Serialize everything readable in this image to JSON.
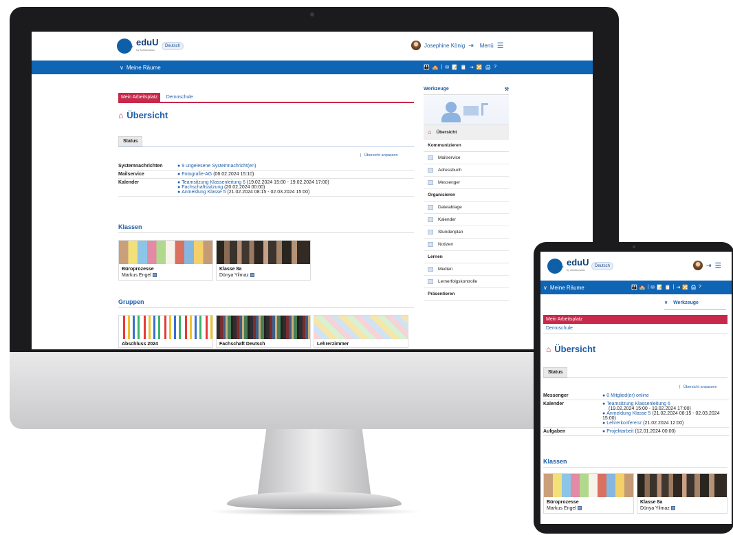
{
  "desktop": {
    "header": {
      "logo": "eduU",
      "logo_sub": "by Ashhkowaio",
      "language": "Deutsch",
      "user_name": "Josephine König",
      "menu": "Menü"
    },
    "bar": {
      "rooms": "Meine Räume",
      "icons": [
        "👪",
        "🏫",
        "|",
        "✉",
        "📝",
        "📋",
        "⇥",
        "🔀",
        "🖨",
        "?"
      ]
    },
    "tabs": {
      "active": "Mein Arbeitsplatz",
      "other": "Demoschule"
    },
    "title": "Übersicht",
    "status_tab": "Status",
    "customize": "Übersicht anpassen",
    "status_rows": [
      {
        "key": "Systemnachrichten",
        "lines": [
          {
            "link": "9 ungelesene Systemnachricht(en)",
            "rest": ""
          }
        ]
      },
      {
        "key": "Mailservice",
        "lines": [
          {
            "link": "Fotografie-AG",
            "rest": "(06.02.2024 15:10)"
          }
        ]
      },
      {
        "key": "Kalender",
        "lines": [
          {
            "link": "Teamsitzung Klassenleitung 6",
            "rest": "(19.02.2024 15:00 - 19.02.2024 17:00)"
          },
          {
            "link": "Fachschaftssitzung",
            "rest": "(20.02.2024 00:00)"
          },
          {
            "link": "Anmeldung Klasse 5",
            "rest": "(21.02.2024 08:15 - 02.03.2024 15:00)"
          }
        ]
      }
    ],
    "klassen_title": "Klassen",
    "klassen": [
      {
        "title": "Büroprozesse",
        "person": "Markus Engel"
      },
      {
        "title": "Klasse 8a",
        "person": "Dünya Yilmaz"
      }
    ],
    "gruppen_title": "Gruppen",
    "gruppen": [
      {
        "title": "Abschluss 2024"
      },
      {
        "title": "Fachschaft Deutsch"
      },
      {
        "title": "Lehrerzimmer"
      }
    ],
    "tools": {
      "title": "Werkzeuge",
      "items": [
        {
          "type": "item",
          "label": "Übersicht",
          "active": true
        },
        {
          "type": "group",
          "label": "Kommunizieren"
        },
        {
          "type": "item",
          "label": "Mailservice"
        },
        {
          "type": "item",
          "label": "Adressbuch"
        },
        {
          "type": "item",
          "label": "Messenger"
        },
        {
          "type": "group",
          "label": "Organisieren"
        },
        {
          "type": "item",
          "label": "Dateiablage"
        },
        {
          "type": "item",
          "label": "Kalender"
        },
        {
          "type": "item",
          "label": "Stundenplan"
        },
        {
          "type": "item",
          "label": "Notizen"
        },
        {
          "type": "group",
          "label": "Lernen"
        },
        {
          "type": "item",
          "label": "Medien"
        },
        {
          "type": "item",
          "label": "Lernerfolgskontrolle"
        },
        {
          "type": "group",
          "label": "Präsentieren"
        }
      ]
    }
  },
  "tablet": {
    "header": {
      "logo": "eduU",
      "logo_sub": "by Ashhkowaio",
      "language": "Deutsch"
    },
    "bar": {
      "rooms": "Meine Räume",
      "icons": [
        "👪",
        "🏫",
        "|",
        "✉",
        "📝",
        "📋",
        "|",
        "⇥",
        "🔀",
        "🖨",
        "?"
      ]
    },
    "tools_toggle": "Werkzeuge",
    "tabs": {
      "active": "Mein Arbeitsplatz",
      "other": "Demoschule"
    },
    "title": "Übersicht",
    "status_tab": "Status",
    "customize": "Übersicht anpassen",
    "status_rows": [
      {
        "key": "Messenger",
        "lines": [
          {
            "link": "0 Mitglied(er) online",
            "rest": ""
          }
        ]
      },
      {
        "key": "Kalender",
        "lines": [
          {
            "link": "Teamsitzung Klassenleitung 6",
            "rest": ""
          },
          {
            "link": "",
            "rest": "(19.02.2024 15:00 - 19.02.2024 17:00)"
          },
          {
            "link": "Anmeldung Klasse 5",
            "rest": "(21.02.2024 08:15 - 02.03.2024 15:00)"
          },
          {
            "link": "Lehrerkonferenz",
            "rest": "(21.02.2024 12:00)"
          }
        ]
      },
      {
        "key": "Aufgaben",
        "lines": [
          {
            "link": "Projektarbeit",
            "rest": "(12.01.2024 00:00)"
          }
        ]
      }
    ],
    "klassen_title": "Klassen",
    "klassen": [
      {
        "title": "Büroprozesse",
        "person": "Markus Engel"
      },
      {
        "title": "Klasse 8a",
        "person": "Dünya Yilmaz"
      }
    ]
  },
  "colors": {
    "brand_blue": "#0f64b4",
    "accent_red": "#c8284a",
    "link_blue": "#1f5fa8"
  }
}
